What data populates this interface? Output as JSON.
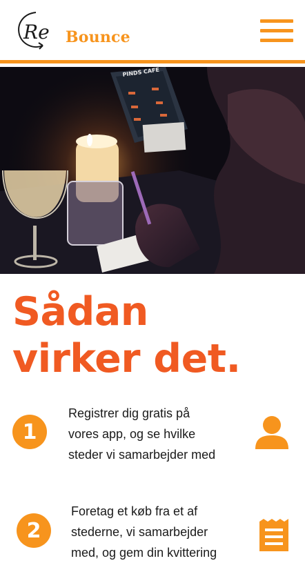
{
  "brand": {
    "logo_text": "Bounce",
    "logo_prefix": "Re",
    "accent": "#f7941d",
    "title_color": "#f05a22"
  },
  "header": {
    "menu_icon": "hamburger-menu-icon"
  },
  "hero": {
    "sign_text": "PINDS CAFE"
  },
  "section": {
    "title_line1": "Sådan",
    "title_line2": "virker det."
  },
  "steps": [
    {
      "number": "1",
      "line1": "Registrer dig gratis på",
      "line2": "vores app, og se hvilke",
      "line3": "steder vi samarbejder med",
      "icon": "user-icon"
    },
    {
      "number": "2",
      "line1": "Foretag et køb fra et  af",
      "line2": "stederne, vi samarbejder",
      "line3": "med, og gem din kvittering",
      "icon": "receipt-icon"
    }
  ]
}
